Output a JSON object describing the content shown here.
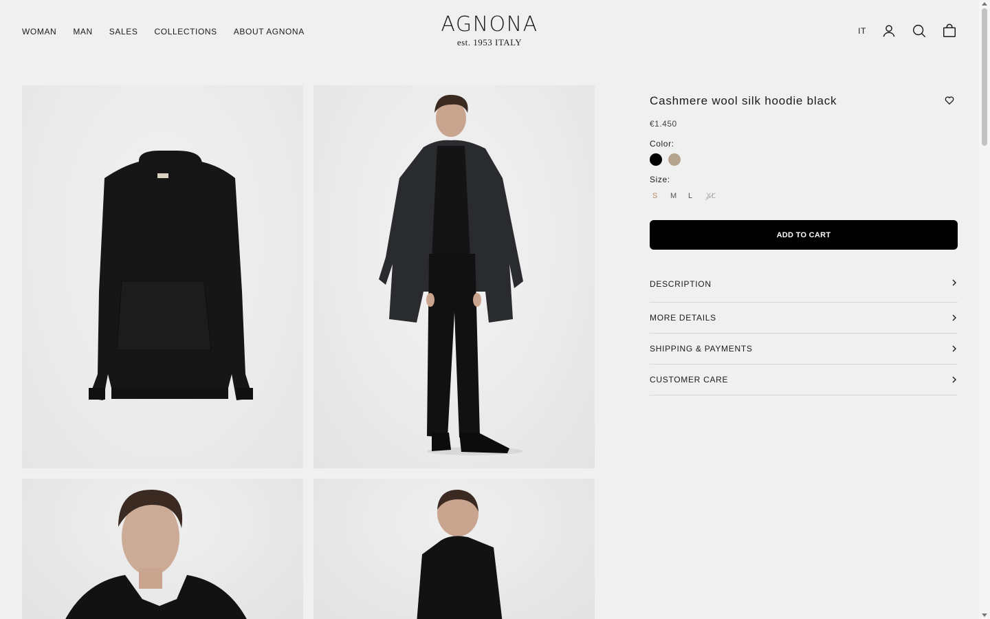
{
  "header": {
    "nav": [
      "WOMAN",
      "MAN",
      "SALES",
      "COLLECTIONS",
      "ABOUT AGNONA"
    ],
    "logo": {
      "brand": "AGNONA",
      "tagline": "est. 1953 ITALY"
    },
    "language": "IT",
    "icons": [
      "account-icon",
      "search-icon",
      "shopping-bag-icon"
    ]
  },
  "product": {
    "title": "Cashmere wool silk hoodie black",
    "price": "€1.450",
    "color_label": "Color:",
    "colors": [
      {
        "name": "black",
        "hex": "#000000",
        "selected": true
      },
      {
        "name": "beige",
        "hex": "#b6a38e",
        "selected": false
      }
    ],
    "size_label": "Size:",
    "sizes": [
      {
        "label": "S",
        "state": "selected"
      },
      {
        "label": "M",
        "state": "available"
      },
      {
        "label": "L",
        "state": "available"
      },
      {
        "label": "XL",
        "state": "unavailable"
      }
    ],
    "add_to_cart": "ADD TO CART",
    "accordion": [
      "DESCRIPTION",
      "MORE DETAILS",
      "SHIPPING & PAYMENTS",
      "CUSTOMER CARE"
    ]
  },
  "gallery": {
    "images": [
      "hoodie-flat-front",
      "model-full-body-with-coat",
      "model-portrait-front",
      "model-side-back"
    ]
  },
  "colors": {
    "background": "#f0f0f0",
    "button": "#000000",
    "selected_size": "#b58a6a"
  }
}
